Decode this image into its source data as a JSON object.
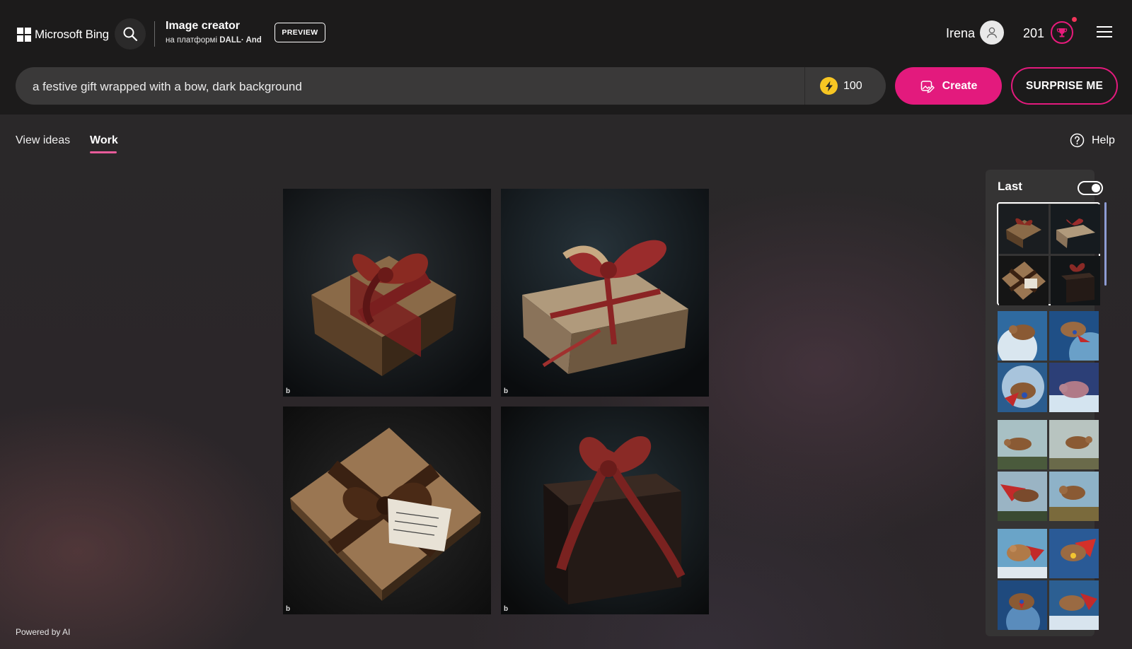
{
  "header": {
    "logo_text": "Microsoft Bing",
    "app_title": "Image creator",
    "app_subtitle_prefix": "на платформі ",
    "app_subtitle_bold": "DALL· And",
    "preview_badge": "PREVIEW",
    "user_name": "Irena",
    "points": "201",
    "icons": {
      "search": "search-icon",
      "avatar": "user-avatar-icon",
      "rewards": "trophy-icon",
      "menu": "hamburger-menu-icon"
    },
    "accent_color": "#e31a7d"
  },
  "prompt": {
    "value": "a festive gift wrapped with a bow, dark background",
    "boosts": "100",
    "create_label": "Create",
    "surprise_label": "SURPRISE ME"
  },
  "tabs": [
    {
      "label": "View ideas",
      "active": false
    },
    {
      "label": "Work",
      "active": true
    }
  ],
  "help_label": "Help",
  "results": {
    "watermark": "b",
    "images": [
      {
        "name": "gift-image-1",
        "bow": "#7a1f1f",
        "box": "#6e5236"
      },
      {
        "name": "gift-image-2",
        "bow": "#8b2424",
        "box": "#8a7256"
      },
      {
        "name": "gift-image-3",
        "bow": "#3a2112",
        "box": "#7a5a3c"
      },
      {
        "name": "gift-image-4",
        "bow": "#8a2a26",
        "box": "#2a1e1a"
      }
    ]
  },
  "history": {
    "title": "Last",
    "toggle_on": true,
    "groups": [
      {
        "name": "history-group-gifts",
        "selected": true,
        "theme": "gift"
      },
      {
        "name": "history-group-capybara-space",
        "selected": false,
        "theme": "space"
      },
      {
        "name": "history-group-capybara-sky",
        "selected": false,
        "theme": "sky"
      },
      {
        "name": "history-group-capybara-hero",
        "selected": false,
        "theme": "hero"
      }
    ]
  },
  "footer": {
    "powered_by": "Powered by AI"
  }
}
